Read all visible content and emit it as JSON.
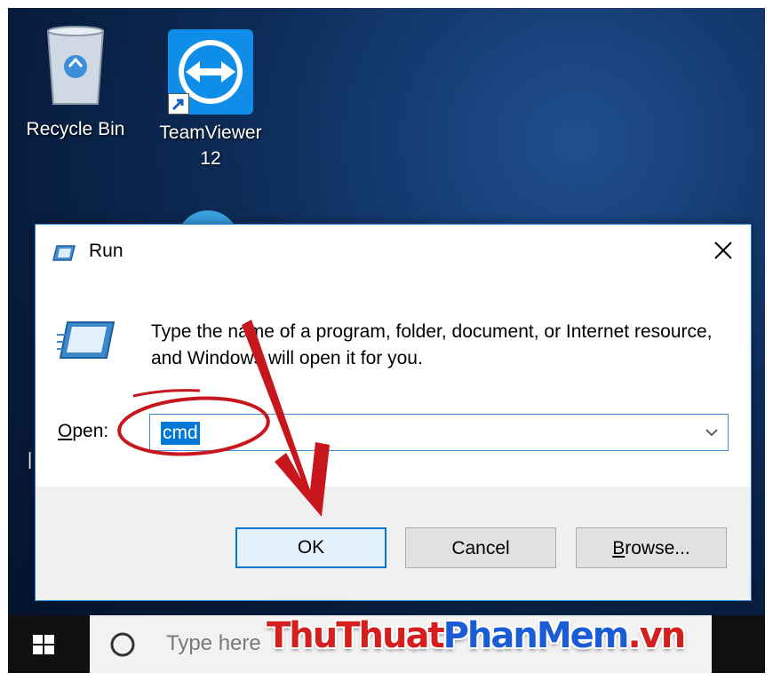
{
  "desktop": {
    "icons": [
      {
        "label": "Recycle Bin",
        "icon": "recycle-bin-icon"
      },
      {
        "label": "TeamViewer",
        "label_line2": "12",
        "icon": "teamviewer-icon"
      }
    ]
  },
  "run_dialog": {
    "title": "Run",
    "description": "Type the name of a program, folder, document, or Internet resource, and Windows will open it for you.",
    "open_label_first": "O",
    "open_label_rest": "pen:",
    "open_value": "cmd",
    "buttons": {
      "ok": "OK",
      "cancel": "Cancel",
      "browse_first": "B",
      "browse_rest": "rowse..."
    },
    "icons": {
      "title": "run-icon",
      "close": "close-icon",
      "dropdown": "chevron-down-icon"
    }
  },
  "taskbar": {
    "search_placeholder": "Type here",
    "icons": {
      "start": "windows-logo-icon",
      "search": "cortana-circle-icon"
    }
  },
  "watermark": {
    "part1": "ThuThuat",
    "part2": "PhanMem",
    "part3": ".vn"
  },
  "colors": {
    "accent": "#0078d7",
    "annotation": "#c8161d",
    "desktop": "#0d2d5a"
  }
}
